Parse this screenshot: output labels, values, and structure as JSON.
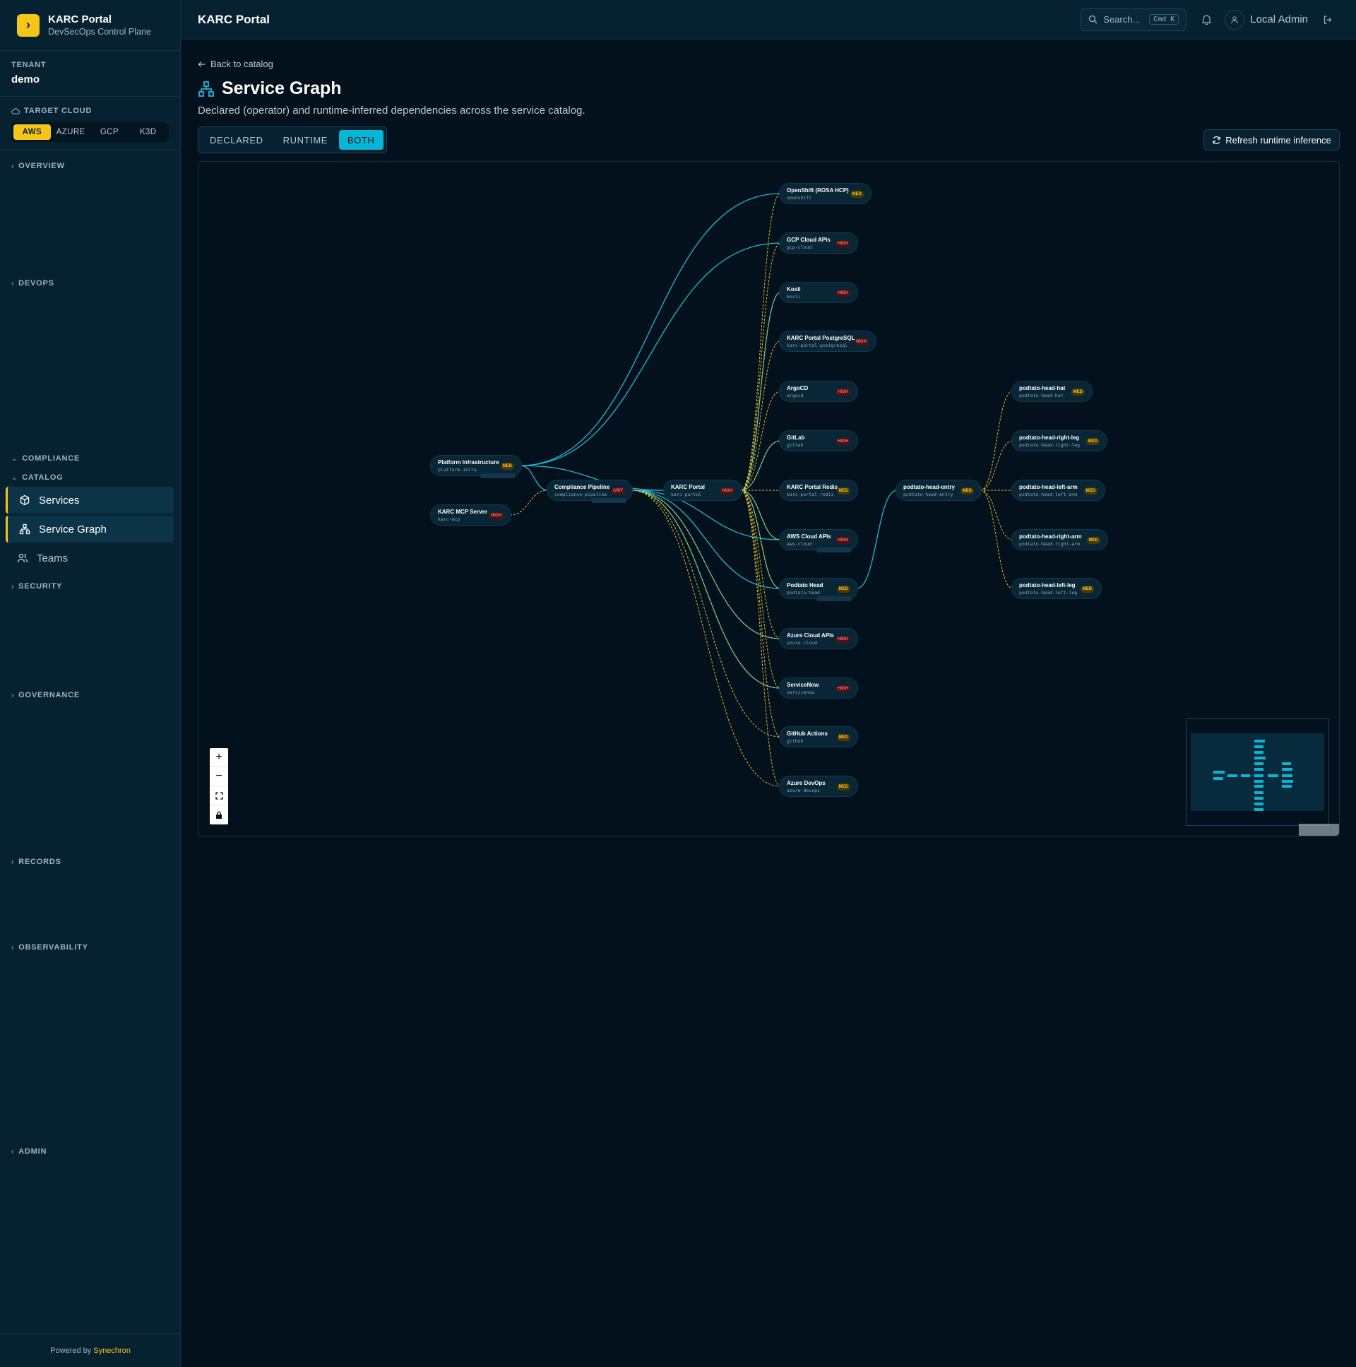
{
  "sidebar": {
    "brand_title": "KARC Portal",
    "brand_subtitle": "DevSecOps Control Plane",
    "tenant_label": "TENANT",
    "tenant_value": "demo",
    "cloud_label": "TARGET CLOUD",
    "clouds": [
      "AWS",
      "AZURE",
      "GCP",
      "K3D"
    ],
    "active_cloud": "AWS",
    "sections": {
      "overview": "OVERVIEW",
      "devops": "DEVOPS",
      "compliance": "COMPLIANCE",
      "catalog": "CATALOG",
      "security": "SECURITY",
      "governance": "GOVERNANCE",
      "records": "RECORDS",
      "observability": "OBSERVABILITY",
      "admin": "ADMIN"
    },
    "catalog_items": [
      "Services",
      "Service Graph",
      "Teams"
    ],
    "powered_by": "Powered by",
    "powered_brand": "Synechron"
  },
  "topbar": {
    "title": "KARC Portal",
    "search_placeholder": "Search...",
    "search_shortcut": "Cmd K",
    "user_name": "Local Admin"
  },
  "page": {
    "back_link": "Back to catalog",
    "title": "Service Graph",
    "subtitle": "Declared (operator) and runtime-inferred dependencies across the service catalog.",
    "modes": [
      "DECLARED",
      "RUNTIME",
      "BOTH"
    ],
    "active_mode": "BOTH",
    "refresh_label": "Refresh runtime inference"
  },
  "colors": {
    "accent": "#f5c518",
    "declared_edge": "#22b8d8",
    "runtime_edge": "#e6c229",
    "active_mode": "#06b6d4"
  },
  "graph": {
    "nodes": [
      {
        "name": "Platform Infrastructure",
        "id": "platform-infra",
        "risk": "MED"
      },
      {
        "name": "KARC MCP Server",
        "id": "karc-mcp",
        "risk": "HIGH"
      },
      {
        "name": "Compliance Pipeline",
        "id": "compliance-pipeline",
        "risk": "CRIT"
      },
      {
        "name": "KARC Portal",
        "id": "karc-portal",
        "risk": "HIGH"
      },
      {
        "name": "OpenShift (ROSA HCP)",
        "id": "openshift",
        "risk": "MED"
      },
      {
        "name": "GCP Cloud APIs",
        "id": "gcp-cloud",
        "risk": "HIGH"
      },
      {
        "name": "Kosli",
        "id": "kosli",
        "risk": "HIGH"
      },
      {
        "name": "KARC Portal PostgreSQL",
        "id": "karc-portal-postgresql",
        "risk": "HIGH"
      },
      {
        "name": "ArgoCD",
        "id": "argocd",
        "risk": "HIGH"
      },
      {
        "name": "GitLab",
        "id": "gitlab",
        "risk": "HIGH"
      },
      {
        "name": "KARC Portal Redis",
        "id": "karc-portal-redis",
        "risk": "MED"
      },
      {
        "name": "AWS Cloud APIs",
        "id": "aws-cloud",
        "risk": "HIGH"
      },
      {
        "name": "Podtato Head",
        "id": "podtato-head",
        "risk": "MED"
      },
      {
        "name": "Azure Cloud APIs",
        "id": "azure-cloud",
        "risk": "HIGH"
      },
      {
        "name": "ServiceNow",
        "id": "servicenow",
        "risk": "HIGH"
      },
      {
        "name": "GitHub Actions",
        "id": "github",
        "risk": "MED"
      },
      {
        "name": "Azure DevOps",
        "id": "azure-devops",
        "risk": "MED"
      },
      {
        "name": "podtato-head-entry",
        "id": "podtato-head-entry",
        "risk": "MED"
      },
      {
        "name": "podtato-head-hat",
        "id": "podtato-head-hat",
        "risk": "MED"
      },
      {
        "name": "podtato-head-right-leg",
        "id": "podtato-head-right-leg",
        "risk": "MED"
      },
      {
        "name": "podtato-head-left-arm",
        "id": "podtato-head-left-arm",
        "risk": "MED"
      },
      {
        "name": "podtato-head-right-arm",
        "id": "podtato-head-right-arm",
        "risk": "MED"
      },
      {
        "name": "podtato-head-left-leg",
        "id": "podtato-head-left-leg",
        "risk": "MED"
      }
    ],
    "zoom_controls": [
      "+",
      "−"
    ]
  }
}
